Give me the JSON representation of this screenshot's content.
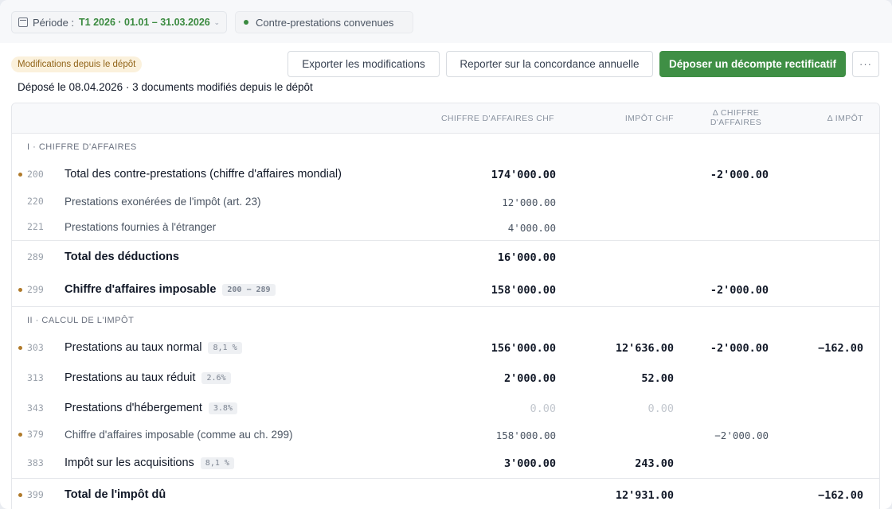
{
  "topbar": {
    "period_label": "Période :",
    "period_value": "T1 2026 · 01.01 – 31.03.2026",
    "status": "Contre-prestations convenues"
  },
  "toolbar": {
    "badge": "Modifications depuis le dépôt",
    "export_label": "Exporter les modifications",
    "report_label": "Reporter sur la concordance annuelle",
    "primary_label": "Déposer un décompte rectificatif",
    "more_label": "···"
  },
  "deposit_line": "Déposé le 08.04.2026 · 3 documents modifiés depuis le dépôt",
  "table": {
    "headers": {
      "ca": "CHIFFRE D'AFFAIRES CHF",
      "imp": "IMPÔT CHF",
      "dca": "Δ CHIFFRE D'AFFAIRES",
      "dimp": "Δ IMPÔT"
    },
    "section1": "I · CHIFFRE D'AFFAIRES",
    "section2": "II · CALCUL DE L'IMPÔT",
    "rows": [
      {
        "code": "200",
        "label": "Total des contre-prestations (chiffre d'affaires mondial)",
        "ca": "174'000.00",
        "imp": "",
        "dca": "-2'000.00",
        "dimp": "",
        "tag": ""
      },
      {
        "code": "220",
        "label": "Prestations exonérées de l'impôt (art. 23)",
        "ca": "12'000.00",
        "imp": "",
        "dca": "",
        "dimp": "",
        "tag": ""
      },
      {
        "code": "221",
        "label": "Prestations fournies à l'étranger",
        "ca": "4'000.00",
        "imp": "",
        "dca": "",
        "dimp": "",
        "tag": ""
      },
      {
        "code": "289",
        "label": "Total des déductions",
        "ca": "16'000.00",
        "imp": "",
        "dca": "",
        "dimp": "",
        "tag": ""
      },
      {
        "code": "299",
        "label": "Chiffre d'affaires imposable",
        "ca": "158'000.00",
        "imp": "",
        "dca": "-2'000.00",
        "dimp": "",
        "tag": "200 − 289"
      },
      {
        "code": "303",
        "label": "Prestations au taux normal",
        "ca": "156'000.00",
        "imp": "12'636.00",
        "dca": "-2'000.00",
        "dimp": "−162.00",
        "tag": "8,1 %"
      },
      {
        "code": "313",
        "label": "Prestations au taux réduit",
        "ca": "2'000.00",
        "imp": "52.00",
        "dca": "",
        "dimp": "",
        "tag": "2.6%"
      },
      {
        "code": "343",
        "label": "Prestations d'hébergement",
        "ca": "0.00",
        "imp": "0.00",
        "dca": "",
        "dimp": "",
        "tag": "3.8%"
      },
      {
        "code": "379",
        "label": "Chiffre d'affaires imposable (comme au ch. 299)",
        "ca": "158'000.00",
        "imp": "",
        "dca": "−2'000.00",
        "dimp": "",
        "tag": ""
      },
      {
        "code": "383",
        "label": "Impôt sur les acquisitions",
        "ca": "3'000.00",
        "imp": "243.00",
        "dca": "",
        "dimp": "",
        "tag": "8,1 %"
      },
      {
        "code": "399",
        "label": "Total de l'impôt dû",
        "ca": "",
        "imp": "12'931.00",
        "dca": "",
        "dimp": "−162.00",
        "tag": ""
      }
    ]
  }
}
